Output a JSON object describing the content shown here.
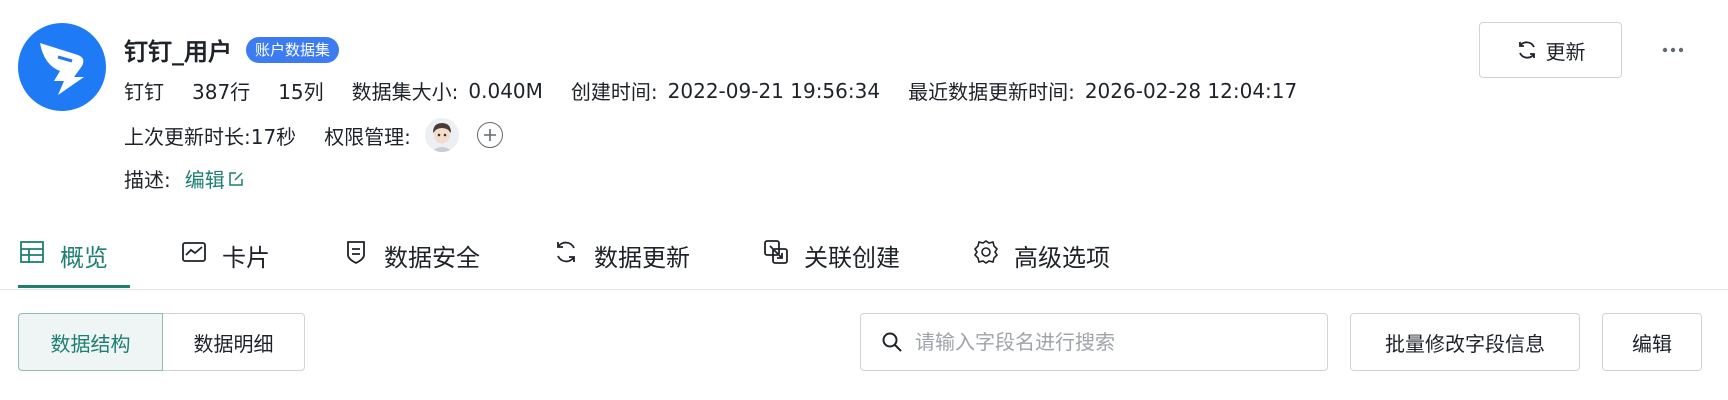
{
  "header": {
    "logo_icon": "dingtalk-logo-icon",
    "title": "钉钉_用户",
    "badge": "账户数据集",
    "meta": {
      "source": "钉钉",
      "rows": "387行",
      "cols": "15列",
      "size_label": "数据集大小:",
      "size_value": "0.040M",
      "created_label": "创建时间:",
      "created_value": "2022-09-21 19:56:34",
      "updated_label": "最近数据更新时间:",
      "updated_value": "2026-02-28 12:04:17"
    },
    "last_duration": "上次更新时长:17秒",
    "permission_label": "权限管理:",
    "description_label": "描述:",
    "edit_link": "编辑",
    "update_button": "更新",
    "more_icon": "more-horizontal-icon"
  },
  "tabs": [
    {
      "label": "概览",
      "icon": "table-icon",
      "active": true
    },
    {
      "label": "卡片",
      "icon": "chart-card-icon"
    },
    {
      "label": "数据安全",
      "icon": "shield-icon"
    },
    {
      "label": "数据更新",
      "icon": "refresh-icon"
    },
    {
      "label": "关联创建",
      "icon": "link-create-icon"
    },
    {
      "label": "高级选项",
      "icon": "gear-icon"
    }
  ],
  "toolbar": {
    "seg_structure": "数据结构",
    "seg_detail": "数据明细",
    "search_placeholder": "请输入字段名进行搜索",
    "search_value": "",
    "bulk_edit": "批量修改字段信息",
    "edit": "编辑"
  },
  "colors": {
    "accent": "#1e7f72",
    "logo_blue": "#1e7bf5",
    "badge_blue": "#3d7cf0"
  }
}
